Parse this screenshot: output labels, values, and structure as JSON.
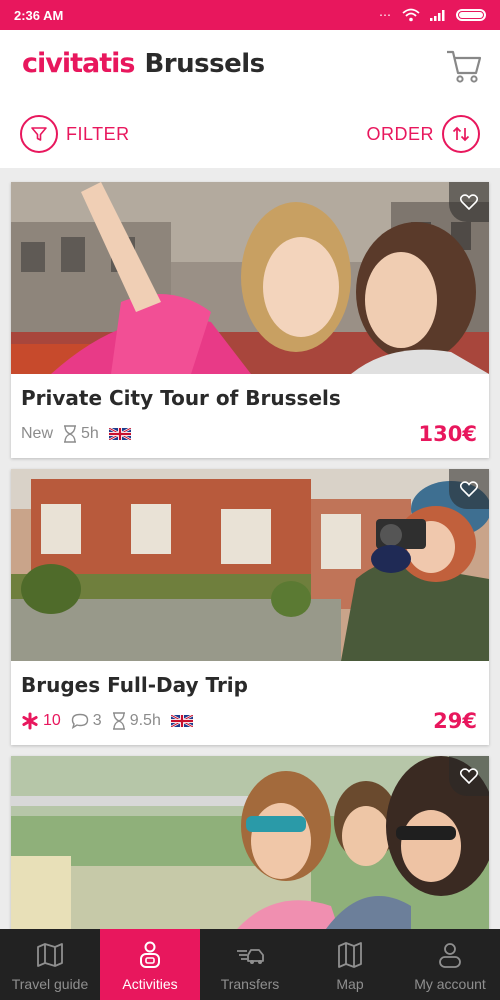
{
  "status_bar": {
    "time": "2:36 AM"
  },
  "header": {
    "logo": "civitatis",
    "city": "Brussels"
  },
  "toolbar": {
    "filter_label": "FILTER",
    "order_label": "ORDER"
  },
  "activities": [
    {
      "title": "Private City Tour of Brussels",
      "tag": "New",
      "duration": "5h",
      "language_flag": "uk-flag-icon",
      "price": "130€"
    },
    {
      "title": "Bruges Full-Day Trip",
      "rating": "10",
      "comments": "3",
      "duration": "9.5h",
      "language_flag": "uk-flag-icon",
      "price": "29€"
    }
  ],
  "nav": [
    {
      "label": "Travel guide",
      "icon": "map-book-icon",
      "active": false
    },
    {
      "label": "Activities",
      "icon": "activities-icon",
      "active": true
    },
    {
      "label": "Transfers",
      "icon": "transfer-car-icon",
      "active": false
    },
    {
      "label": "Map",
      "icon": "map-icon",
      "active": false
    },
    {
      "label": "My account",
      "icon": "account-icon",
      "active": false
    }
  ],
  "colors": {
    "brand": "#e8175d",
    "nav_bg": "#222222"
  }
}
